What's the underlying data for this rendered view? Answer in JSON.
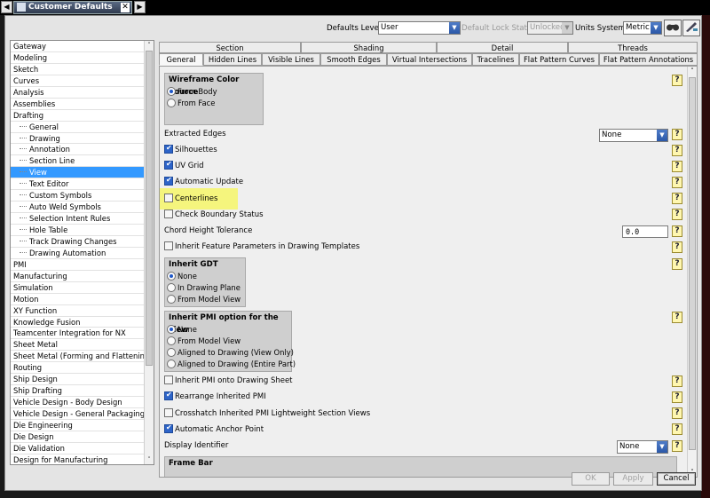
{
  "window": {
    "tab_title": "Customer Defaults",
    "nav_left": "◀",
    "nav_right": "▶",
    "close_glyph": "✕"
  },
  "toolbar": {
    "defaults_level_label": "Defaults Level",
    "defaults_level_value": "User",
    "lock_state_label": "Default Lock State",
    "lock_state_value": "Unlocked",
    "units_label": "Units System",
    "units_value": "Metric",
    "arrow_glyph": "▼"
  },
  "sidebar": {
    "items": [
      {
        "label": "Gateway",
        "child": false
      },
      {
        "label": "Modeling",
        "child": false
      },
      {
        "label": "Sketch",
        "child": false
      },
      {
        "label": "Curves",
        "child": false
      },
      {
        "label": "Analysis",
        "child": false
      },
      {
        "label": "Assemblies",
        "child": false
      },
      {
        "label": "Drafting",
        "child": false
      },
      {
        "label": "General",
        "child": true
      },
      {
        "label": "Drawing",
        "child": true
      },
      {
        "label": "Annotation",
        "child": true
      },
      {
        "label": "Section Line",
        "child": true
      },
      {
        "label": "View",
        "child": true,
        "selected": true
      },
      {
        "label": "Text Editor",
        "child": true
      },
      {
        "label": "Custom Symbols",
        "child": true
      },
      {
        "label": "Auto Weld Symbols",
        "child": true
      },
      {
        "label": "Selection Intent Rules",
        "child": true
      },
      {
        "label": "Hole Table",
        "child": true
      },
      {
        "label": "Track Drawing Changes",
        "child": true
      },
      {
        "label": "Drawing Automation",
        "child": true
      },
      {
        "label": "PMI",
        "child": false
      },
      {
        "label": "Manufacturing",
        "child": false
      },
      {
        "label": "Simulation",
        "child": false
      },
      {
        "label": "Motion",
        "child": false
      },
      {
        "label": "XY Function",
        "child": false
      },
      {
        "label": "Knowledge Fusion",
        "child": false
      },
      {
        "label": "Teamcenter Integration for NX",
        "child": false
      },
      {
        "label": "Sheet Metal",
        "child": false
      },
      {
        "label": "Sheet Metal (Forming and Flattening)",
        "child": false
      },
      {
        "label": "Routing",
        "child": false
      },
      {
        "label": "Ship Design",
        "child": false
      },
      {
        "label": "Ship Drafting",
        "child": false
      },
      {
        "label": "Vehicle Design - Body Design",
        "child": false
      },
      {
        "label": "Vehicle Design - General Packaging",
        "child": false
      },
      {
        "label": "Die Engineering",
        "child": false
      },
      {
        "label": "Die Design",
        "child": false
      },
      {
        "label": "Die Validation",
        "child": false
      },
      {
        "label": "Design for Manufacturing",
        "child": false
      }
    ],
    "scroll_up": "˄",
    "scroll_down": "˅"
  },
  "tabs_top": [
    "Section",
    "Shading",
    "Detail",
    "Threads"
  ],
  "tabs_bottom": [
    "General",
    "Hidden Lines",
    "Visible Lines",
    "Smooth Edges",
    "Virtual Intersections",
    "Tracelines",
    "Flat Pattern Curves",
    "Flat Pattern Annotations"
  ],
  "active_tab": "General",
  "content": {
    "help_glyph": "?",
    "wireframe": {
      "title": "Wireframe Color Source",
      "opt1": "From Body",
      "opt2": "From Face"
    },
    "extracted_edges_label": "Extracted Edges",
    "extracted_edges_value": "None",
    "silhouettes": "Silhouettes",
    "uv_grid": "UV Grid",
    "automatic_update": "Automatic Update",
    "centerlines": "Centerlines",
    "check_boundary": "Check Boundary Status",
    "chord_label": "Chord Height Tolerance",
    "chord_value": "0.0",
    "inherit_feature": "Inherit Feature Parameters in Drawing Templates",
    "inherit_gdt": {
      "title": "Inherit GDT",
      "opt1": "None",
      "opt2": "In Drawing Plane",
      "opt3": "From Model View"
    },
    "inherit_pmi": {
      "title": "Inherit PMI option for the view",
      "opt1": "None",
      "opt2": "From Model View",
      "opt3": "Aligned to Drawing (View Only)",
      "opt4": "Aligned to Drawing (Entire Part)"
    },
    "inherit_pmi_sheet": "Inherit PMI onto Drawing Sheet",
    "rearrange_pmi": "Rearrange Inherited PMI",
    "crosshatch": "Crosshatch Inherited PMI Lightweight Section Views",
    "anchor_point": "Automatic Anchor Point",
    "display_identifier_label": "Display Identifier",
    "display_identifier_value": "None",
    "frame_bar": "Frame Bar"
  },
  "buttons": {
    "ok": "OK",
    "apply": "Apply",
    "cancel": "Cancel"
  },
  "colors": {
    "selection": "#3399ff",
    "highlight": "#f5f570",
    "accent": "#2d64c8"
  }
}
